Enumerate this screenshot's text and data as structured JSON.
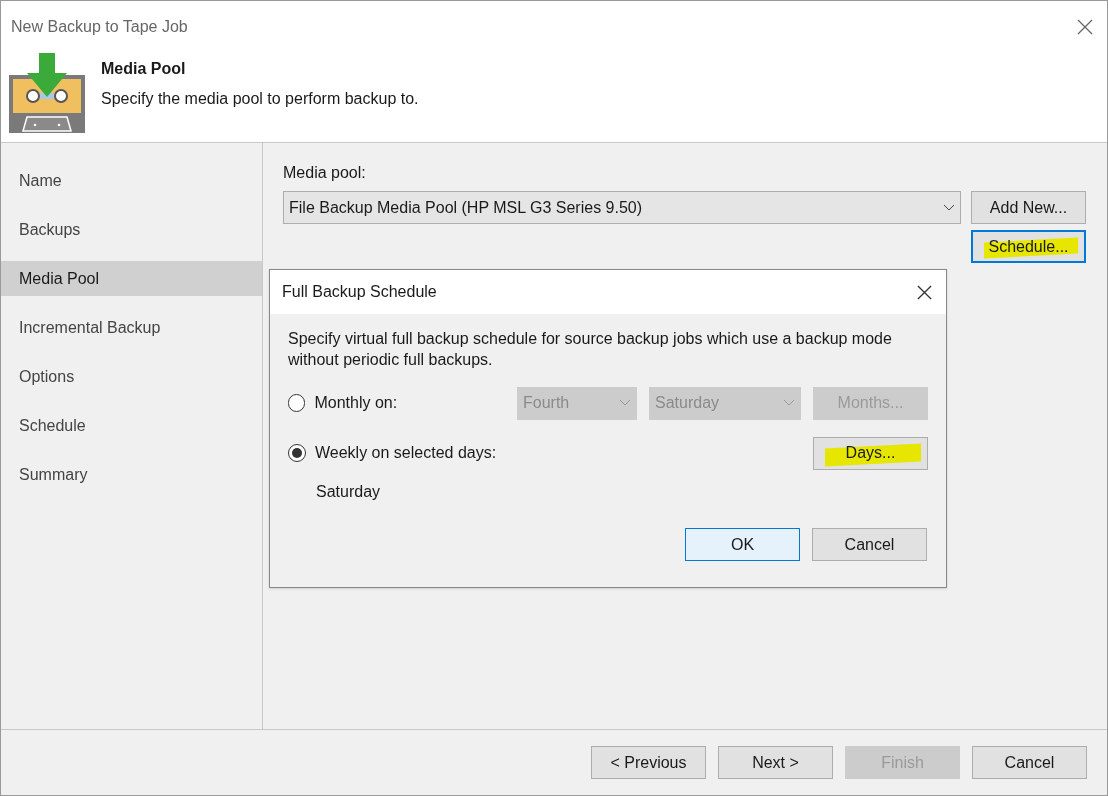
{
  "window": {
    "title": "New Backup to Tape Job"
  },
  "header": {
    "title": "Media Pool",
    "subtitle": "Specify the media pool to perform backup to."
  },
  "sidebar": {
    "items": [
      {
        "label": "Name",
        "selected": false
      },
      {
        "label": "Backups",
        "selected": false
      },
      {
        "label": "Media Pool",
        "selected": true
      },
      {
        "label": "Incremental Backup",
        "selected": false
      },
      {
        "label": "Options",
        "selected": false
      },
      {
        "label": "Schedule",
        "selected": false
      },
      {
        "label": "Summary",
        "selected": false
      }
    ]
  },
  "media_pool": {
    "label": "Media pool:",
    "value": "File Backup Media Pool (HP MSL G3 Series 9.50)",
    "add_button": {
      "label": "Add New...",
      "focused": false,
      "highlighted": false
    },
    "schedule_button": {
      "label": "Schedule...",
      "focused": true,
      "highlighted": true
    }
  },
  "dialog": {
    "title": "Full Backup Schedule",
    "description": "Specify virtual full backup schedule for source backup jobs which use a backup mode without periodic full backups.",
    "options": [
      {
        "kind": "monthly",
        "label": "Monthly on:",
        "selected": false,
        "week": "Fourth",
        "day": "Saturday",
        "button": {
          "label": "Months...",
          "disabled": true,
          "highlighted": false
        }
      },
      {
        "kind": "weekly",
        "label": "Weekly on selected days:",
        "selected": true,
        "button": {
          "label": "Days...",
          "disabled": false,
          "highlighted": true
        },
        "days": "Saturday"
      }
    ],
    "buttons": [
      {
        "label": "OK",
        "default": true
      },
      {
        "label": "Cancel",
        "default": false
      }
    ]
  },
  "footer": {
    "buttons": [
      {
        "label": "< Previous",
        "disabled": false
      },
      {
        "label": "Next >",
        "disabled": false
      },
      {
        "label": "Finish",
        "disabled": true
      },
      {
        "label": "Cancel",
        "disabled": false
      }
    ]
  }
}
